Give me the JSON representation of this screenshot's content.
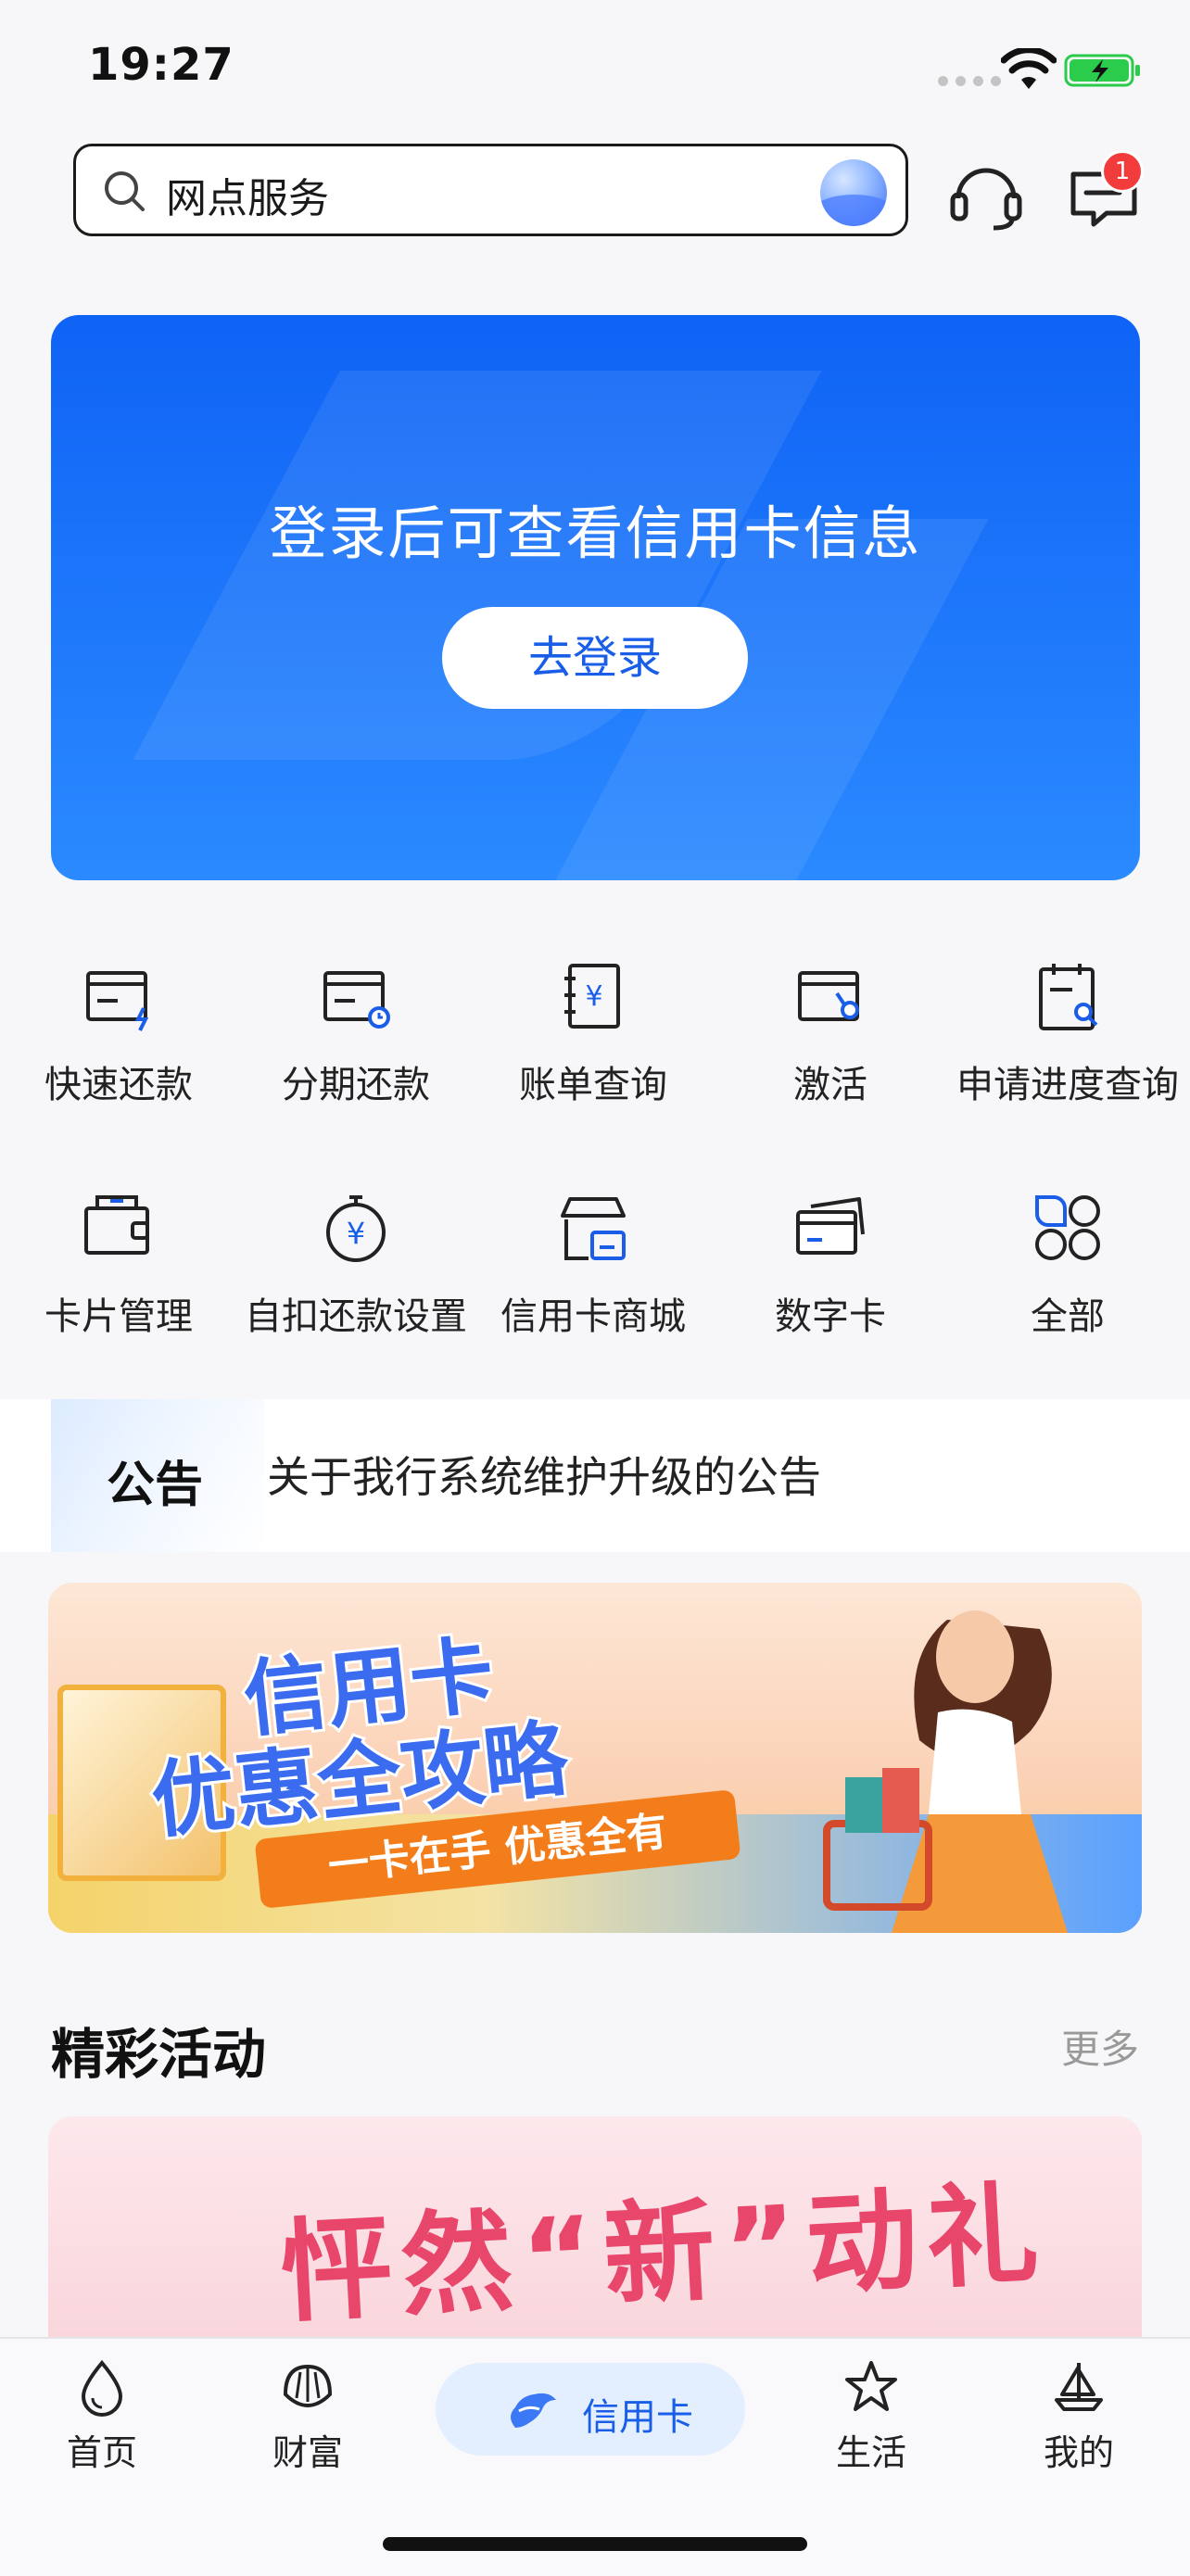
{
  "status_bar": {
    "time": "19:27"
  },
  "search": {
    "text": "网点服务"
  },
  "header": {
    "message_badge": "1"
  },
  "hero": {
    "title": "登录后可查看信用卡信息",
    "login_button": "去登录"
  },
  "grid": {
    "items": [
      {
        "label": "快速还款",
        "icon": "quick-repay-icon"
      },
      {
        "label": "分期还款",
        "icon": "installment-icon"
      },
      {
        "label": "账单查询",
        "icon": "bill-query-icon"
      },
      {
        "label": "激活",
        "icon": "activate-icon"
      },
      {
        "label": "申请进度查询",
        "icon": "application-progress-icon"
      },
      {
        "label": "卡片管理",
        "icon": "card-manage-icon"
      },
      {
        "label": "自扣还款设置",
        "icon": "auto-debit-icon"
      },
      {
        "label": "信用卡商城",
        "icon": "mall-icon"
      },
      {
        "label": "数字卡",
        "icon": "digital-card-icon"
      },
      {
        "label": "全部",
        "icon": "all-icon"
      }
    ]
  },
  "notice": {
    "tag": "公告",
    "text": "关于我行系统维护升级的公告"
  },
  "promo": {
    "title_line1": "信用卡",
    "title_line2": "优惠全攻略",
    "slogan": "一卡在手 优惠全有"
  },
  "activities": {
    "title": "精彩活动",
    "more": "更多",
    "card_text": "怦然“新”动礼"
  },
  "tabbar": {
    "items": [
      {
        "label": "首页",
        "icon": "home-icon"
      },
      {
        "label": "财富",
        "icon": "wealth-icon"
      },
      {
        "label": "信用卡",
        "icon": "credit-card-icon",
        "active": true
      },
      {
        "label": "生活",
        "icon": "life-icon"
      },
      {
        "label": "我的",
        "icon": "mine-icon"
      }
    ]
  },
  "colors": {
    "accent": "#1a5ee8",
    "hero_top": "#0f63f5",
    "hero_bottom": "#2b8aff",
    "badge": "#f23b3b"
  }
}
